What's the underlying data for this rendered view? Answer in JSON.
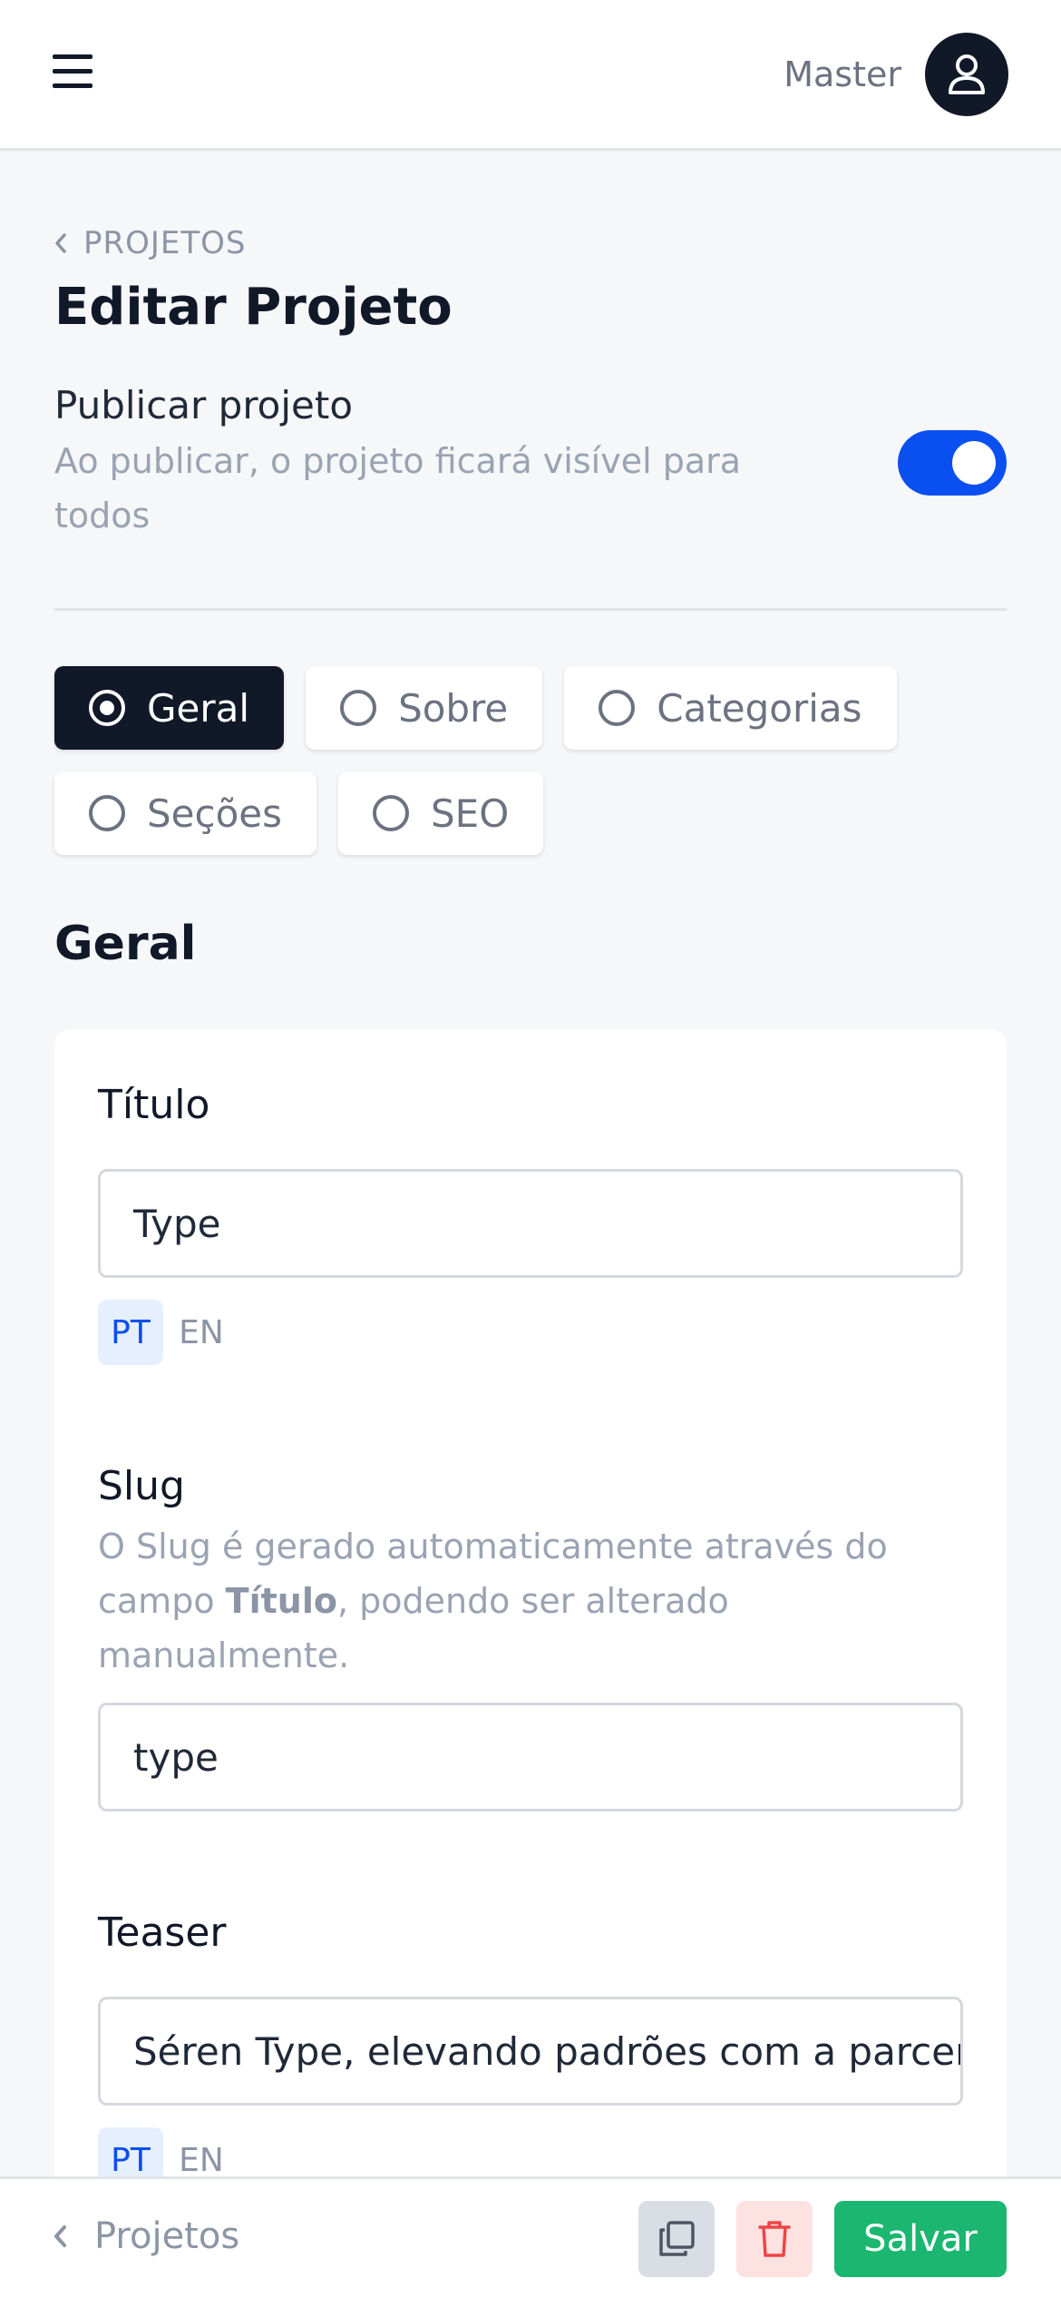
{
  "header": {
    "user_name": "Master"
  },
  "breadcrumb": {
    "label": "PROJETOS"
  },
  "page": {
    "title": "Editar Projeto"
  },
  "publish": {
    "title": "Publicar projeto",
    "description": "Ao publicar, o projeto ficará visível para todos",
    "enabled": true
  },
  "tabs": [
    {
      "label": "Geral",
      "selected": true
    },
    {
      "label": "Sobre",
      "selected": false
    },
    {
      "label": "Categorias",
      "selected": false
    },
    {
      "label": "Seções",
      "selected": false
    },
    {
      "label": "SEO",
      "selected": false
    }
  ],
  "section": {
    "title": "Geral"
  },
  "fields": {
    "titulo": {
      "label": "Título",
      "value": "Type",
      "langs": [
        "PT",
        "EN"
      ]
    },
    "slug": {
      "label": "Slug",
      "help_before": "O Slug é gerado automaticamente através do campo ",
      "help_bold": "Título",
      "help_after": ", podendo ser alterado manualmente.",
      "value": "type"
    },
    "teaser": {
      "label": "Teaser",
      "value": "Séren Type, elevando padrões com a parceria",
      "langs": [
        "PT",
        "EN"
      ]
    }
  },
  "footer": {
    "back_label": "Projetos",
    "save_label": "Salvar"
  },
  "colors": {
    "toggle_on": "#0a4ff0",
    "save": "#1bb66f",
    "delete_bg": "#fde2e2",
    "delete_icon": "#ef4444"
  }
}
